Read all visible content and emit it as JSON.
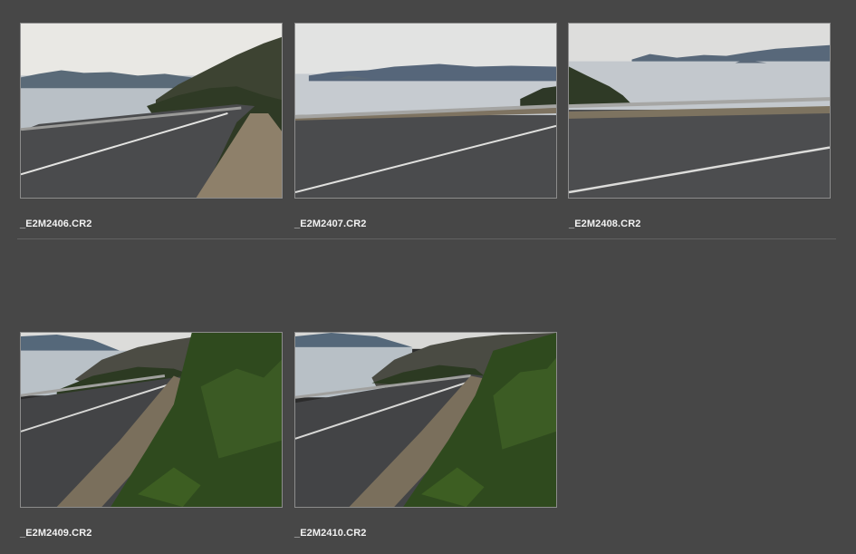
{
  "browser": {
    "items": [
      {
        "filename": "_E2M2406.CR2",
        "scene": "road curving left along coast, hillside on right"
      },
      {
        "filename": "_E2M2407.CR2",
        "scene": "road with guardrail, sea and islands behind"
      },
      {
        "filename": "_E2M2408.CR2",
        "scene": "road with guardrail, wide sea and distant islands"
      },
      {
        "filename": "_E2M2409.CR2",
        "scene": "road curving right, green shrubs in foreground"
      },
      {
        "filename": "_E2M2410.CR2",
        "scene": "road curving right, green shrubs in foreground"
      }
    ]
  }
}
